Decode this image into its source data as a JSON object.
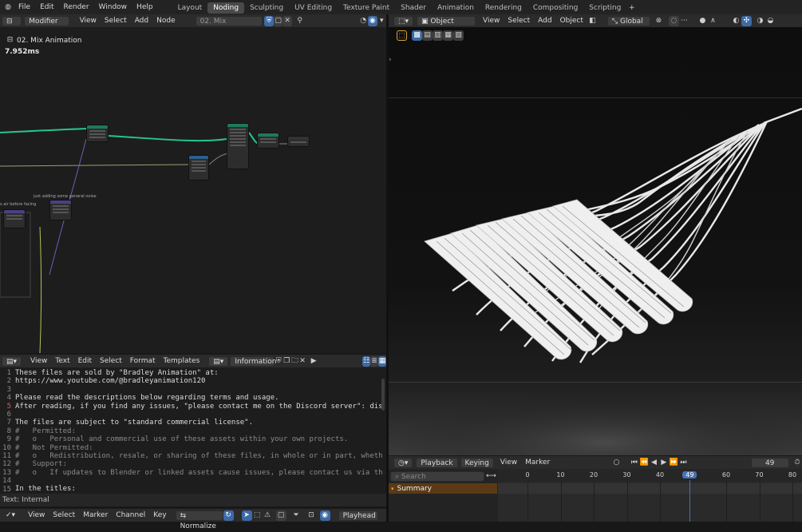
{
  "topbar": {
    "menus": [
      "File",
      "Edit",
      "Render",
      "Window",
      "Help"
    ],
    "tabs": [
      "Layout",
      "Noding",
      "Sculpting",
      "UV Editing",
      "Texture Paint",
      "Shader",
      "Animation",
      "Rendering",
      "Compositing",
      "Scripting"
    ],
    "active_tab": "Noding"
  },
  "node_editor": {
    "type_label": "Modifier",
    "menus": [
      "View",
      "Select",
      "Add",
      "Node"
    ],
    "tree_name": "02. Mix Animation",
    "breadcrumb": "02. Mix Animation",
    "timing": "7.952ms",
    "frame_labels": [
      "s air before facing",
      "just adding some general noise"
    ]
  },
  "viewport": {
    "mode": "Object Mode",
    "menus": [
      "View",
      "Select",
      "Add",
      "Object"
    ],
    "transform": "Global"
  },
  "text_editor": {
    "menus": [
      "View",
      "Text",
      "Edit",
      "Select",
      "Format",
      "Templates"
    ],
    "text_name": "Information",
    "lines": [
      "These files are sold by \"Bradley Animation\" at:",
      "https://www.youtube.com/@bradleyanimation120",
      "",
      "Please read the descriptions below regarding terms and usage.",
      "After reading, if you find any issues, \"please contact me on the Discord server\": discord.gg/Tz",
      "",
      "The files are subject to \"standard commercial license\".",
      "#   Permitted:",
      "#   o   Personal and commercial use of these assets within your own projects.",
      "#   Not Permitted:",
      "#   o   Redistribution, resale, or sharing of these files, in whole or in part, whether in thei",
      "#   Support:",
      "#   o   If updates to Blender or linked assets cause issues, please contact us via the Discord",
      "",
      "In the titles:"
    ],
    "footer": "Text: Internal"
  },
  "timeline": {
    "menus": [
      "Playback",
      "Keying",
      "View",
      "Marker"
    ],
    "current_frame": "49",
    "search_placeholder": "Search",
    "summary": "Summary",
    "ticks": [
      "0",
      "10",
      "20",
      "30",
      "40",
      "49",
      "60",
      "70",
      "80"
    ]
  },
  "bottom_editor": {
    "menus": [
      "View",
      "Select",
      "Marker",
      "Channel",
      "Key"
    ],
    "normalize": "Normalize",
    "playhead": "Playhead"
  },
  "colors": {
    "accent": "#4772b3",
    "node_green": "#1d7a5c",
    "string_yellow": "#e9d46a",
    "keyword_red": "#ea5b5b"
  }
}
